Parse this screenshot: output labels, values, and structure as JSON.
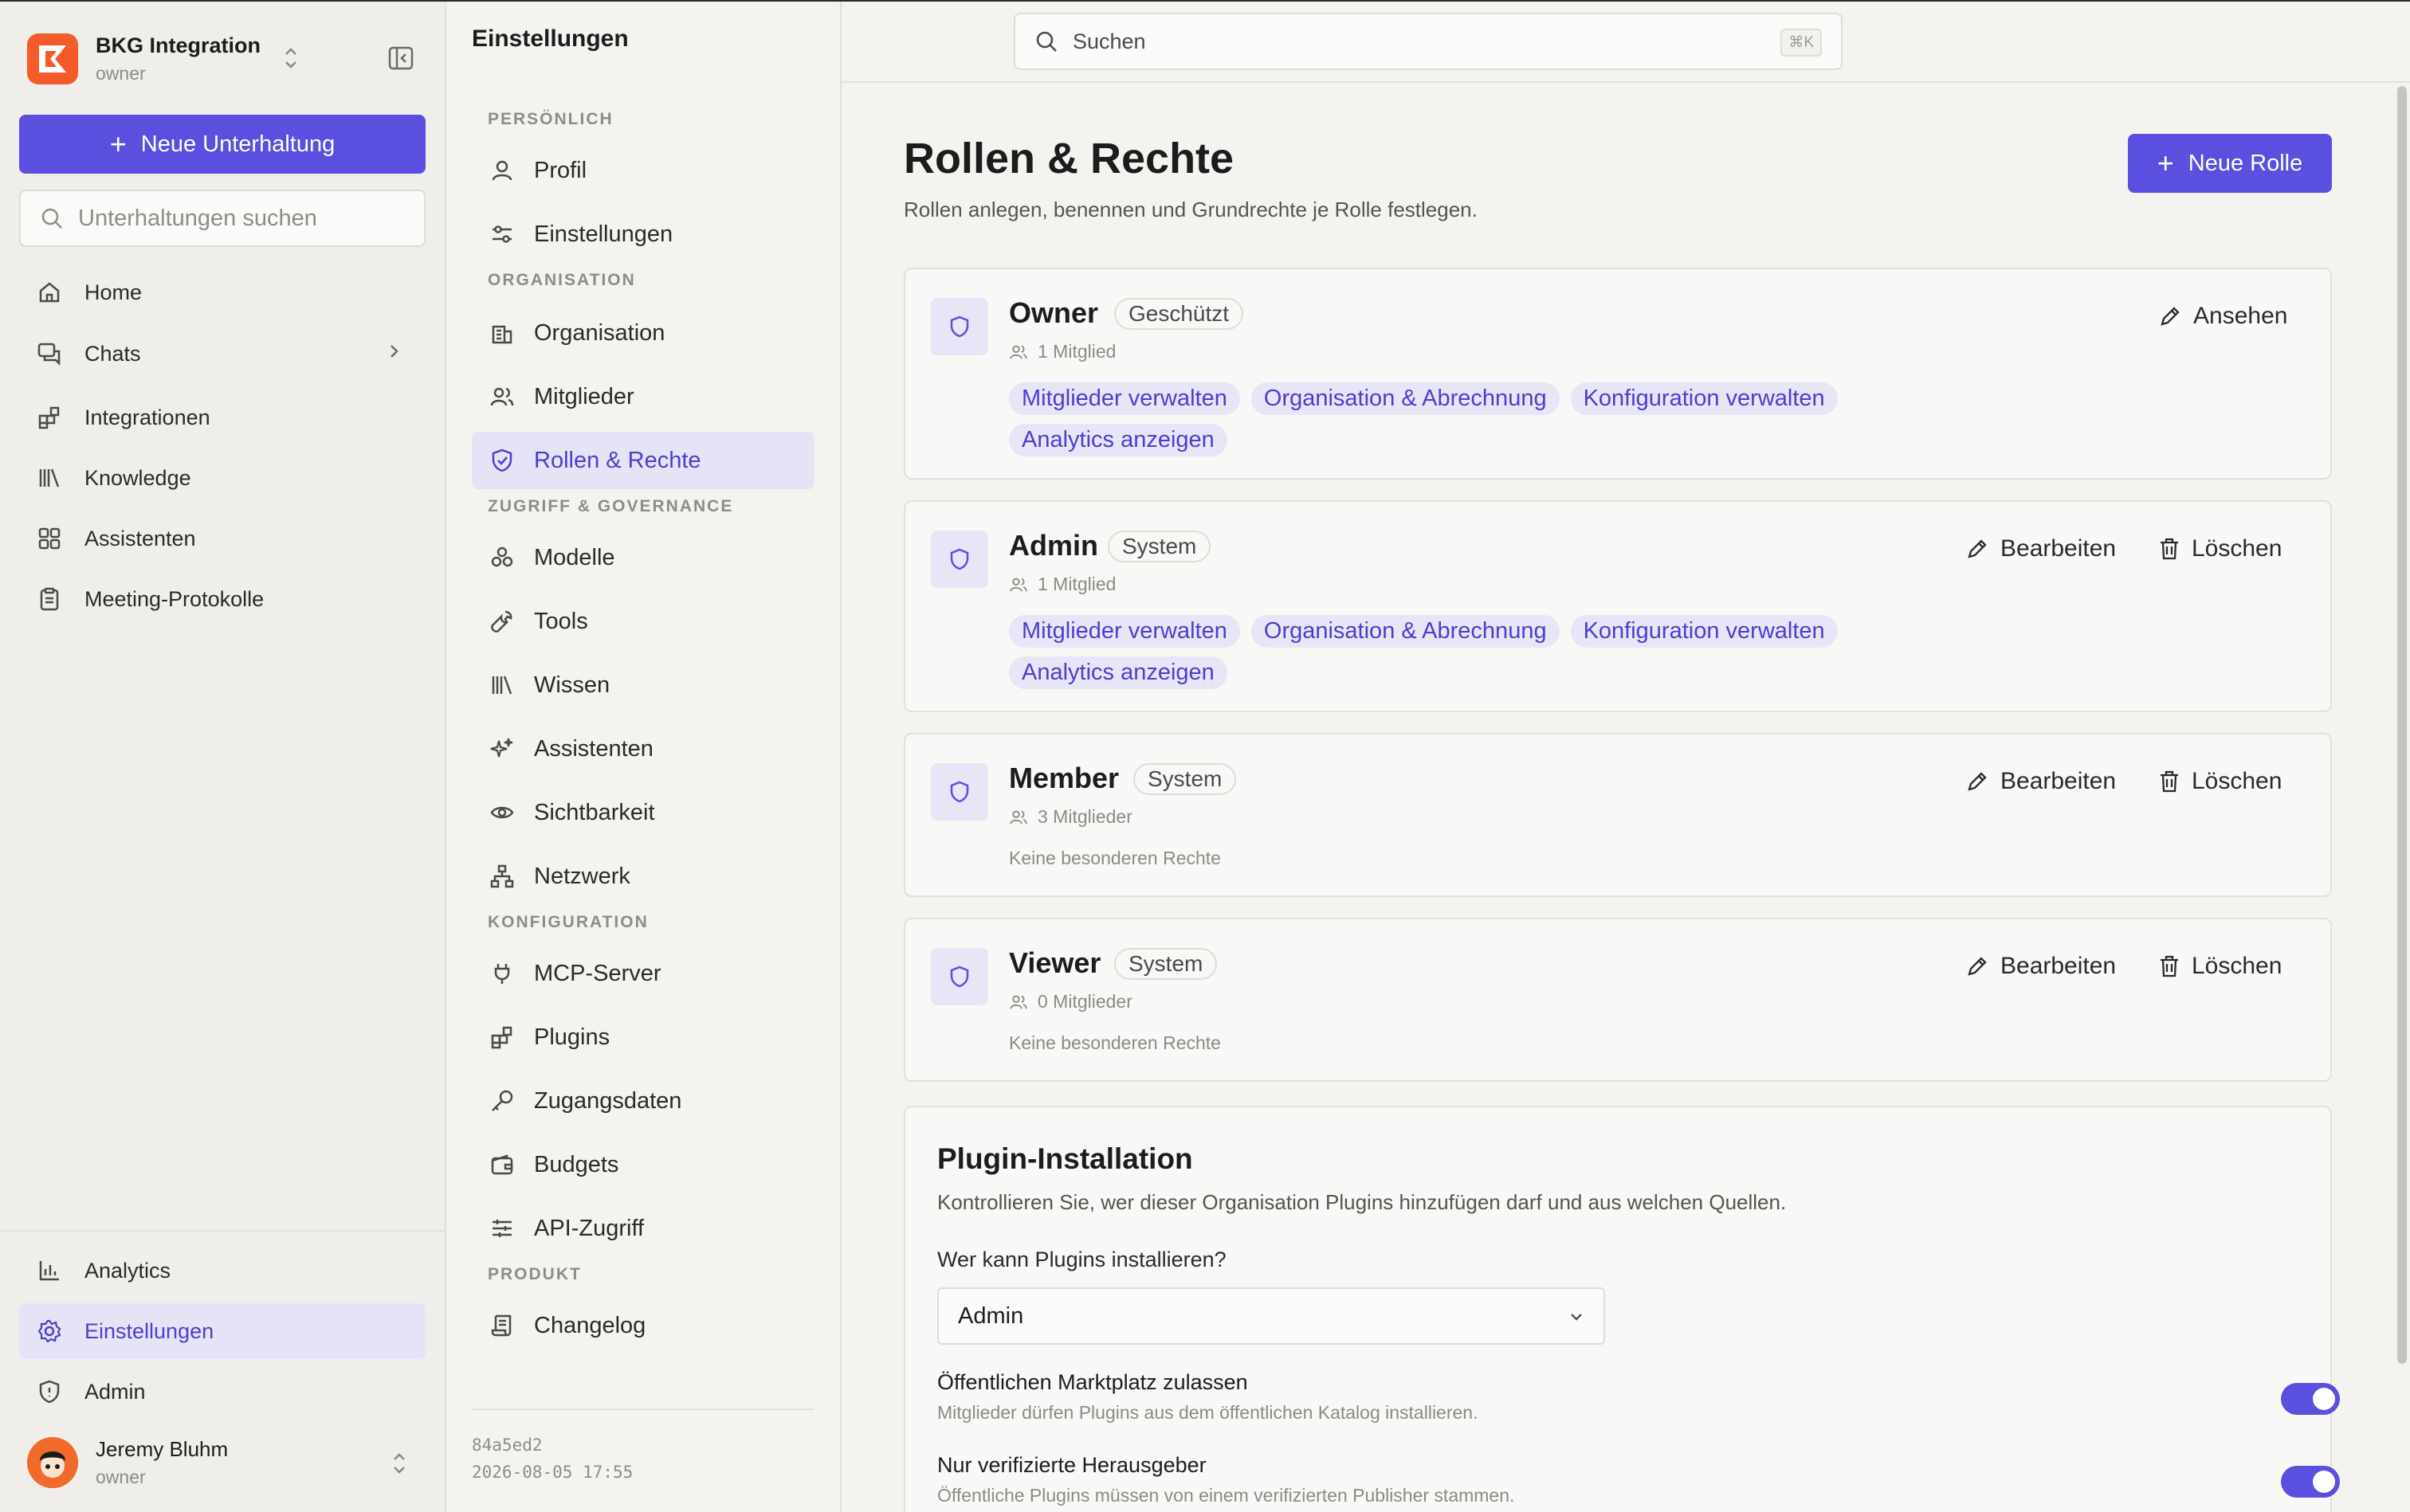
{
  "workspace": {
    "name": "BKG Integration",
    "role": "owner"
  },
  "sidebar": {
    "new_chat_label": "Neue Unterhaltung",
    "search_placeholder": "Unterhaltungen suchen",
    "items": [
      {
        "label": "Home",
        "icon": "home-icon"
      },
      {
        "label": "Chats",
        "icon": "chat-icon"
      },
      {
        "label": "Integrationen",
        "icon": "integrations-icon"
      },
      {
        "label": "Knowledge",
        "icon": "library-icon"
      },
      {
        "label": "Assistenten",
        "icon": "grid-icon"
      },
      {
        "label": "Meeting-Protokolle",
        "icon": "clipboard-icon"
      }
    ],
    "bottom_items": [
      {
        "label": "Analytics",
        "icon": "bar-chart-icon"
      },
      {
        "label": "Einstellungen",
        "icon": "gear-icon",
        "active": true
      },
      {
        "label": "Admin",
        "icon": "shield-icon"
      }
    ]
  },
  "user": {
    "name": "Jeremy Bluhm",
    "role": "owner"
  },
  "settings_nav": {
    "title": "Einstellungen",
    "sections": [
      {
        "label": "PERSÖNLICH",
        "items": [
          "Profil",
          "Einstellungen"
        ]
      },
      {
        "label": "ORGANISATION",
        "items": [
          "Organisation",
          "Mitglieder",
          "Rollen & Rechte"
        ]
      },
      {
        "label": "ZUGRIFF & GOVERNANCE",
        "items": [
          "Modelle",
          "Tools",
          "Wissen",
          "Assistenten",
          "Sichtbarkeit",
          "Netzwerk"
        ]
      },
      {
        "label": "KONFIGURATION",
        "items": [
          "MCP-Server",
          "Plugins",
          "Zugangsdaten",
          "Budgets",
          "API-Zugriff"
        ]
      },
      {
        "label": "PRODUKT",
        "items": [
          "Changelog"
        ]
      }
    ],
    "active": "Rollen & Rechte",
    "version": "84a5ed2",
    "build_date": "2026-08-05 17:55"
  },
  "topbar": {
    "search_placeholder": "Suchen",
    "shortcut": "⌘K"
  },
  "main": {
    "title": "Rollen & Rechte",
    "subtitle": "Rollen anlegen, benennen und Grundrechte je Rolle festlegen.",
    "new_role_label": "Neue Rolle",
    "roles": [
      {
        "name": "Owner",
        "badge": "Geschützt",
        "members": "1 Mitglied",
        "permissions": [
          "Mitglieder verwalten",
          "Organisation & Abrechnung",
          "Konfiguration verwalten",
          "Analytics anzeigen"
        ],
        "actions": [
          "Ansehen"
        ]
      },
      {
        "name": "Admin",
        "badge": "System",
        "members": "1 Mitglied",
        "permissions": [
          "Mitglieder verwalten",
          "Organisation & Abrechnung",
          "Konfiguration verwalten",
          "Analytics anzeigen"
        ],
        "actions": [
          "Bearbeiten",
          "Löschen"
        ]
      },
      {
        "name": "Member",
        "badge": "System",
        "members": "3 Mitglieder",
        "no_rights": "Keine besonderen Rechte",
        "actions": [
          "Bearbeiten",
          "Löschen"
        ]
      },
      {
        "name": "Viewer",
        "badge": "System",
        "members": "0 Mitglieder",
        "no_rights": "Keine besonderen Rechte",
        "actions": [
          "Bearbeiten",
          "Löschen"
        ]
      }
    ],
    "plugin_install": {
      "title": "Plugin-Installation",
      "description": "Kontrollieren Sie, wer dieser Organisation Plugins hinzufügen darf und aus welchen Quellen.",
      "who_label": "Wer kann Plugins installieren?",
      "who_value": "Admin",
      "toggles": [
        {
          "title": "Öffentlichen Marktplatz zulassen",
          "desc": "Mitglieder dürfen Plugins aus dem öffentlichen Katalog installieren.",
          "on": true
        },
        {
          "title": "Nur verifizierte Herausgeber",
          "desc": "Öffentliche Plugins müssen von einem verifizierten Publisher stammen.",
          "on": true
        }
      ]
    }
  },
  "colors": {
    "accent": "#5b4fe0",
    "accent_soft": "#e8e5f7",
    "brand": "#f45b2a"
  }
}
